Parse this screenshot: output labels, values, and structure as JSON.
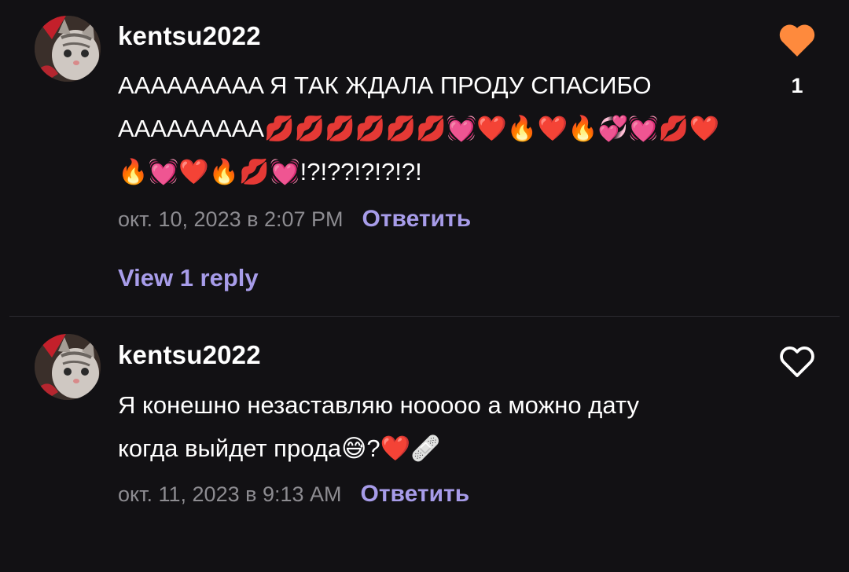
{
  "comments": [
    {
      "username": "kentsu2022",
      "text": "АААААААAA Я ТАК ЖДАЛА ПРОДУ СПАСИБО АААААААAA💋💋💋💋💋💋💓❤️🔥❤️🔥💞💓💋❤️🔥💓❤️🔥💋💓!?!??!?!?!?!",
      "timestamp": "окт. 10, 2023 в 2:07 PM",
      "reply_label": "Ответить",
      "view_replies_label": "View 1 reply",
      "likes": "1",
      "liked": true,
      "avatar_icon": "cat-avatar"
    },
    {
      "username": "kentsu2022",
      "text": "Я конешно незаставляю нооооо а можно дату когда выйдет прода😅?❤️🩹",
      "timestamp": "окт. 11, 2023 в 9:13 AM",
      "reply_label": "Ответить",
      "liked": false,
      "avatar_icon": "cat-avatar"
    }
  ],
  "colors": {
    "background": "#121114",
    "accent": "#a79ce9",
    "liked_heart": "#fe8a3d",
    "meta_text": "#8d8c91"
  }
}
